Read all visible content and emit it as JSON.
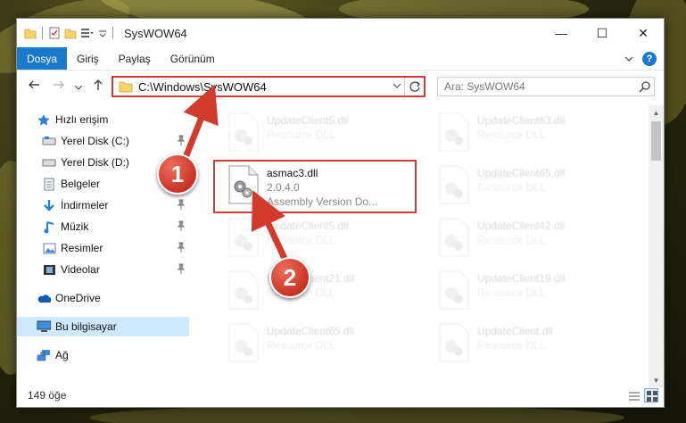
{
  "window": {
    "title": "SysWOW64",
    "controls": {
      "minimize": "—",
      "maximize": "☐",
      "close": "✕"
    }
  },
  "ribbon": {
    "tabs": [
      "Dosya",
      "Giriş",
      "Paylaş",
      "Görünüm"
    ],
    "help_label": "?"
  },
  "address": {
    "path": "C:\\Windows\\SysWOW64",
    "search_placeholder": "Ara: SysWOW64"
  },
  "sidebar": {
    "items": [
      {
        "label": "Hızlı erişim",
        "icon": "star-icon",
        "pinned": false
      },
      {
        "label": "Yerel Disk (C:)",
        "icon": "drive-icon",
        "pinned": true
      },
      {
        "label": "Yerel Disk (D:)",
        "icon": "drive-icon",
        "pinned": false
      },
      {
        "label": "Belgeler",
        "icon": "documents-icon",
        "pinned": true
      },
      {
        "label": "İndirmeler",
        "icon": "download-icon",
        "pinned": true
      },
      {
        "label": "Müzik",
        "icon": "music-icon",
        "pinned": true
      },
      {
        "label": "Resimler",
        "icon": "pictures-icon",
        "pinned": true
      },
      {
        "label": "Videolar",
        "icon": "videos-icon",
        "pinned": true
      },
      {
        "label": "OneDrive",
        "icon": "cloud-icon",
        "pinned": false
      },
      {
        "label": "Bu bilgisayar",
        "icon": "computer-icon",
        "pinned": false
      },
      {
        "label": "Ağ",
        "icon": "network-icon",
        "pinned": false
      }
    ]
  },
  "files": {
    "left": [
      {
        "name": "UpdateClient5.dll",
        "type": "Resource DLL"
      },
      {
        "name": "asmac3.dll",
        "version": "2.0.4.0",
        "type": "Assembly Version Do..."
      },
      {
        "name": "UpdateClient5.dll",
        "type": "Resource DLL"
      },
      {
        "name": "UpdateClient21.dll",
        "type": "Resource DLL"
      },
      {
        "name": "UpdateClient65.dll",
        "type": "Resource DLL"
      }
    ],
    "right": [
      {
        "name": "UpdateClient63.dll",
        "type": "Resource DLL"
      },
      {
        "name": "UpdateClient65.dll",
        "type": "Resource DLL"
      },
      {
        "name": "UpdateClient42.dll",
        "type": "Resource DLL"
      },
      {
        "name": "UpdateClient19.dll",
        "type": "Resource DLL"
      },
      {
        "name": "UpdateClient.dll",
        "type": "Resource DLL"
      }
    ]
  },
  "status": {
    "item_count": "149 öğe"
  },
  "callouts": {
    "one": "1",
    "two": "2"
  },
  "colors": {
    "accent": "#1979ca",
    "highlight": "#cf3a3a",
    "selected": "#cde8ff"
  }
}
